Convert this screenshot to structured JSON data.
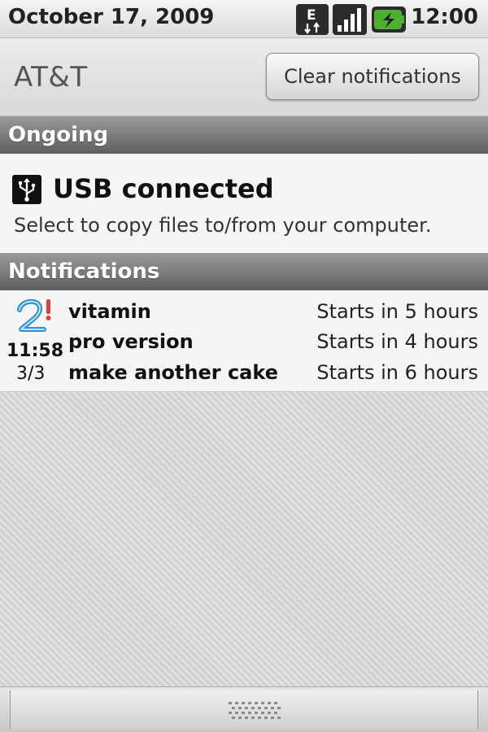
{
  "status_bar": {
    "date": "October 17, 2009",
    "time": "12:00",
    "icons": [
      "edge-data-icon",
      "signal-strength-icon",
      "battery-charging-icon"
    ],
    "edge_label": "E"
  },
  "header": {
    "carrier": "AT&T",
    "clear_button_label": "Clear notifications"
  },
  "ongoing": {
    "section_label": "Ongoing",
    "items": [
      {
        "icon": "usb-icon",
        "title": "USB connected",
        "description": "Select to copy files to/from your computer."
      }
    ]
  },
  "notifications": {
    "section_label": "Notifications",
    "group": {
      "icon": "reminder-app-icon",
      "time": "11:58",
      "count": "3/3",
      "items": [
        {
          "title": "vitamin",
          "when": "Starts in 5 hours"
        },
        {
          "title": "pro version",
          "when": "Starts in 4 hours"
        },
        {
          "title": "make another cake",
          "when": "Starts in 6 hours"
        }
      ]
    }
  },
  "colors": {
    "section_header_top": "#9b9b9b",
    "section_header_bottom": "#5f5f5f",
    "battery_accent": "#4caf2f",
    "app_icon_blue": "#2a8fd6",
    "app_icon_red": "#e04040"
  }
}
